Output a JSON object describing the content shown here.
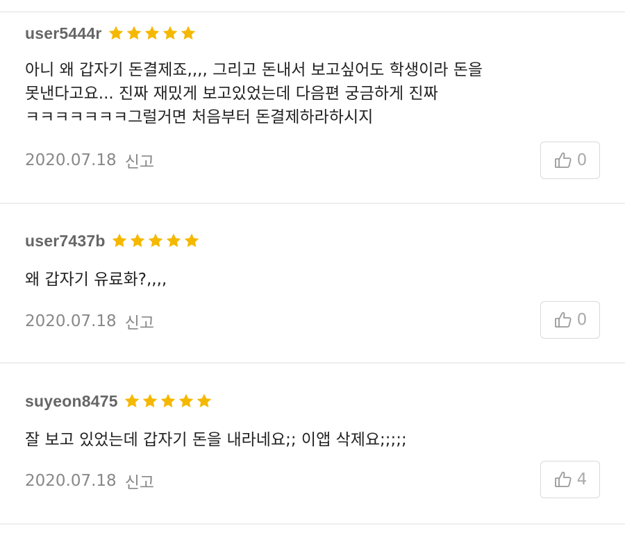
{
  "colors": {
    "star": "#F5B800",
    "username": "#666666",
    "meta": "#888888",
    "divider": "#EEEEEE",
    "like_border": "#D9D9D9"
  },
  "icons": {
    "rating": "star-icon",
    "like": "thumbs-up-icon"
  },
  "reviews": [
    {
      "username": "user5444r",
      "rating": 5,
      "text": "아니 왜 갑자기 돈결제죠,,,, 그리고 돈내서 보고싶어도 학생이라 돈을\n못낸다고요... 진짜 재밌게 보고있었는데 다음편 궁금하게 진짜\nㅋㅋㅋㅋㅋㅋㅋ그럴거면 처음부터 돈결제하라하시지",
      "date": "2020.07.18",
      "report_label": "신고",
      "likes": "0"
    },
    {
      "username": "user7437b",
      "rating": 5,
      "text": "왜 갑자기 유료화?,,,,",
      "date": "2020.07.18",
      "report_label": "신고",
      "likes": "0"
    },
    {
      "username": "suyeon8475",
      "rating": 5,
      "text": "잘 보고 있었는데 갑자기 돈을 내라네요;;  이앱 삭제요;;;;;",
      "date": "2020.07.18",
      "report_label": "신고",
      "likes": "4"
    }
  ]
}
